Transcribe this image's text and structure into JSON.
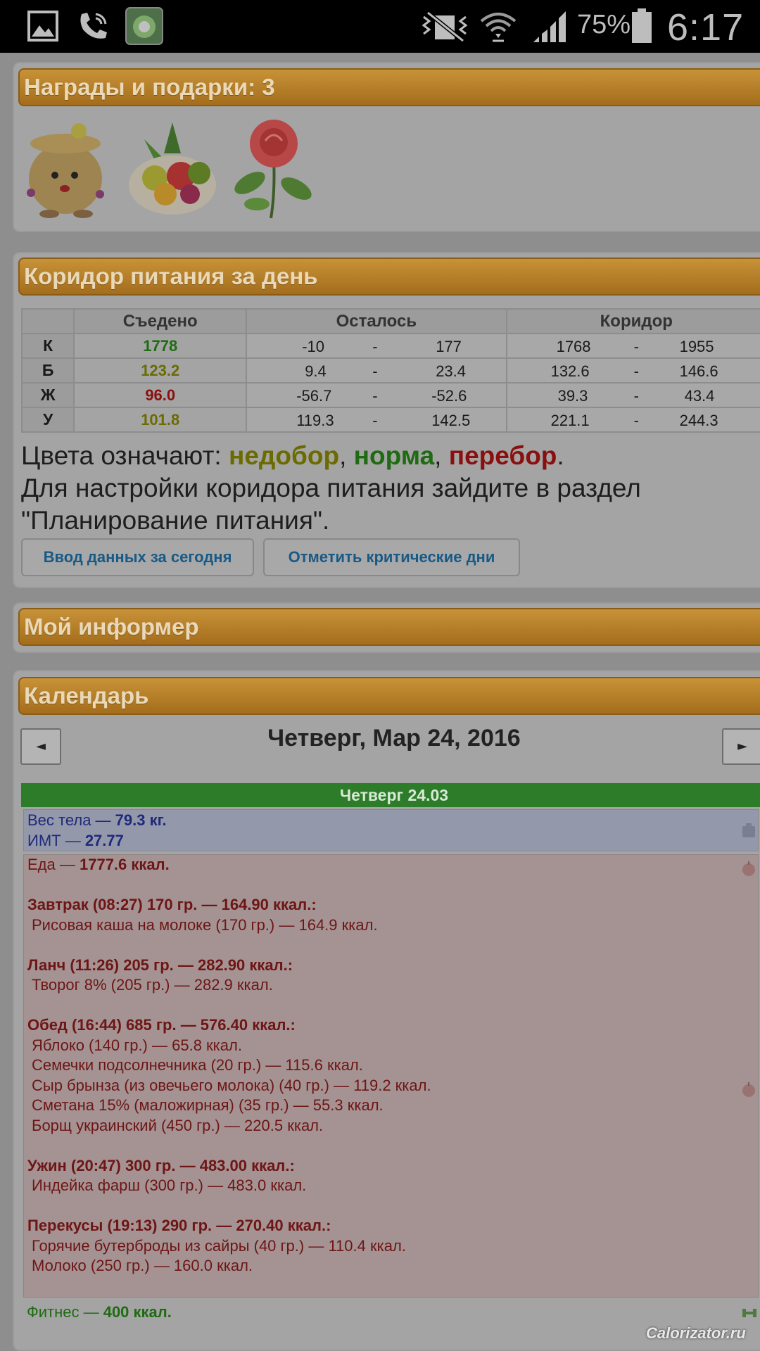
{
  "statusbar": {
    "battery_percent": "75%",
    "time": "6:17"
  },
  "awards": {
    "title": "Награды и подарки: 3",
    "toggle": "–"
  },
  "corridor": {
    "title": "Коридор питания за день",
    "toggle": "–",
    "headers": [
      "Съедено",
      "Осталось",
      "Коридор"
    ],
    "rows": [
      {
        "label": "К",
        "eaten": "1778",
        "eaten_color": "green",
        "left_min": "-10",
        "left_max": "177",
        "corr_min": "1768",
        "corr_max": "1955"
      },
      {
        "label": "Б",
        "eaten": "123.2",
        "eaten_color": "olive",
        "left_min": "9.4",
        "left_max": "23.4",
        "corr_min": "132.6",
        "corr_max": "146.6"
      },
      {
        "label": "Ж",
        "eaten": "96.0",
        "eaten_color": "red",
        "left_min": "-56.7",
        "left_max": "-52.6",
        "corr_min": "39.3",
        "corr_max": "43.4"
      },
      {
        "label": "У",
        "eaten": "101.8",
        "eaten_color": "olive",
        "left_min": "119.3",
        "left_max": "142.5",
        "corr_min": "221.1",
        "corr_max": "244.3"
      }
    ],
    "dash": "-",
    "legend_prefix": "Цвета означают: ",
    "legend_under": "недобор",
    "legend_norm": "норма",
    "legend_over": "перебор",
    "legend_sep": ", ",
    "legend_end": ".",
    "setup_text": "Для настройки коридора питания зайдите в раздел \"Планирование питания\".",
    "btn_enter": "Ввод данных за сегодня",
    "btn_critical": "Отметить критические дни"
  },
  "informer": {
    "title": "Мой информер",
    "toggle": "+"
  },
  "calendar": {
    "title": "Календарь",
    "toggle": "–",
    "prev": "◄",
    "next": "►",
    "date": "Четверг, Мар 24, 2016",
    "day_bar": "Четверг 24.03",
    "weight_label": "Вес тела — ",
    "weight_value": "79.3 кг.",
    "bmi_label": "ИМТ — ",
    "bmi_value": "27.77",
    "food_label": "Еда — ",
    "food_value": "1777.6 ккал.",
    "meals": [
      {
        "title": "Завтрак (08:27) 170 гр. — 164.90 ккал.:",
        "items": [
          "Рисовая каша на молоке (170 гр.) — 164.9 ккал."
        ]
      },
      {
        "title": "Ланч (11:26) 205 гр. — 282.90 ккал.:",
        "items": [
          "Творог 8% (205 гр.) — 282.9 ккал."
        ]
      },
      {
        "title": "Обед (16:44) 685 гр. — 576.40 ккал.:",
        "items": [
          "Яблоко (140 гр.) — 65.8 ккал.",
          "Семечки подсолнечника (20 гр.) — 115.6 ккал.",
          "Сыр брынза (из овечьего молока) (40 гр.) — 119.2 ккал.",
          "Сметана 15% (маложирная) (35 гр.) — 55.3 ккал.",
          "Борщ украинский (450 гр.) — 220.5 ккал."
        ]
      },
      {
        "title": "Ужин (20:47) 300 гр. — 483.00 ккал.:",
        "items": [
          "Индейка фарш (300 гр.) — 483.0 ккал."
        ]
      },
      {
        "title": "Перекусы (19:13) 290 гр. — 270.40 ккал.:",
        "items": [
          "Горячие бутерброды из сайры (40 гр.) — 110.4 ккал.",
          "Молоко (250 гр.) — 160.0 ккал."
        ]
      }
    ],
    "fitness_label": "Фитнес — ",
    "fitness_value": "400 ккал."
  },
  "watermark": "Calorizator.ru"
}
